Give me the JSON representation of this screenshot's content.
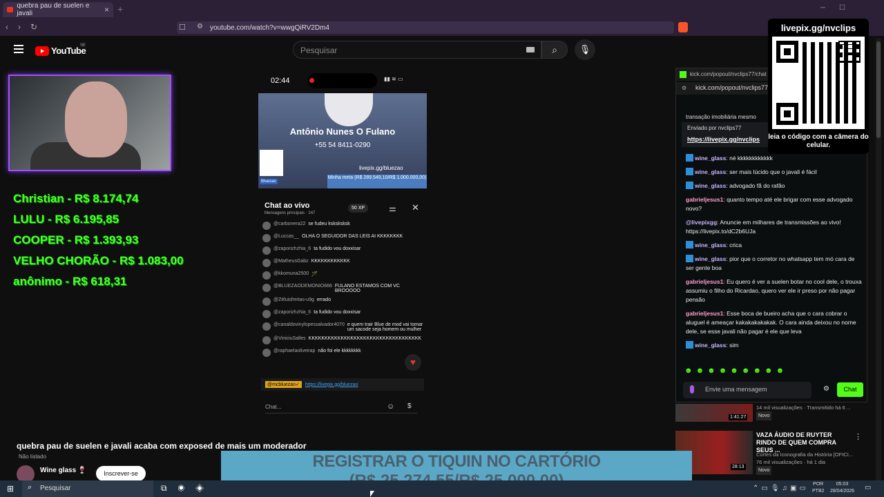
{
  "browser": {
    "tab_title": "quebra pau de suelen e javali",
    "url": "youtube.com/watch?v=wwgQiRV2Dm4"
  },
  "youtube": {
    "logo": "YouTube",
    "region": "SE",
    "search_placeholder": "Pesquisar"
  },
  "donors": [
    "Christian - R$ 8.174,74",
    "LULU - R$ 6.195,85",
    "COOPER - R$ 1.393,93",
    "VELHO CHORÃO - R$ 1.083,00",
    "anônimo - R$ 618,31"
  ],
  "phone": {
    "time": "02:44",
    "banner_name": "Antônio Nunes O Fulano",
    "banner_phone": "+55 54 8411-0290",
    "banner_link": "livepix.gg/bluezao",
    "banner_meta": "Minha meta (R$ 289.549,10/R$ 1.000.000,00)",
    "bluezao_tag": "Bluezao",
    "chat_title": "Chat ao vivo",
    "chat_sub": "Mensagens principais · 247",
    "xp": "50 XP",
    "messages": [
      {
        "user": "@carbonera22",
        "text": "se fudeu ksksksksk"
      },
      {
        "user": "@Luccas__",
        "text": "OLHA O SEGUIDOR DAS LEIS AI KKKKKKKK"
      },
      {
        "user": "@zaporizhzhia_6",
        "text": "ta fudido vou doxxisar"
      },
      {
        "user": "@MatheusGabz",
        "text": "KKKKKKKKKKKK"
      },
      {
        "user": "@kkomuna2500",
        "text": "🪄"
      },
      {
        "user": "@BLUEZAODEMONIO666",
        "text": "FULANO ESTAMOS COM VC BROOOOO"
      },
      {
        "user": "@Zéluisfreitas-u9g",
        "text": "errado"
      },
      {
        "user": "@zaporizhzhia_6",
        "text": "ta fudido vou doxxisar"
      },
      {
        "user": "@canaldovinylopessalvador4070",
        "text": "e quem trair Blue de mod vai tomar um sacode seja homem ou mulher"
      },
      {
        "user": "@ViniciuSalles",
        "text": "KKKKKKKKKKKKKKKKKKKKKKKKKKKKKKKKKKK"
      },
      {
        "user": "@raphaelaoliveirap",
        "text": "não foi ele kkkkkkkk"
      }
    ],
    "pinned_user": "@mcbluezao✓",
    "pinned_link": "https://livepix.gg/bluezao",
    "input_placeholder": "Chat..."
  },
  "video": {
    "title": "quebra pau de suelen e javali acaba com exposed de mais um moderador",
    "visibility": "Não listado",
    "channel": "Wine glass 🍷",
    "subscribe": "Inscrever-se"
  },
  "kick": {
    "tab_url": "kick.com/popout/nvclips77/chat",
    "addr": "kick.com/popout/nvclips77/chat",
    "topline": "transação imobiliária mesmo",
    "pin_sender": "Enviado por nvclips77",
    "pin_link": "https://livepix.gg/nvclips",
    "messages": [
      {
        "user": "wine_glass",
        "color": "#c9b6ff",
        "badge": true,
        "text": "né kkkkkkkkkkkk"
      },
      {
        "user": "wine_glass",
        "color": "#c9b6ff",
        "badge": true,
        "text": "ser mais lúcido que o javali é fácil"
      },
      {
        "user": "wine_glass",
        "color": "#c9b6ff",
        "badge": true,
        "text": "advogado fã do rafão"
      },
      {
        "user": "gabrieljesus1",
        "color": "#ff9ecf",
        "badge": false,
        "text": "quanto tempo até ele brigar com esse advogado novo?"
      },
      {
        "user": "@livepixgg",
        "color": "#c9b6ff",
        "badge": false,
        "text": "Anuncie em milhares de transmissões ao vivo! https://livepix.to/dC2b6UJa"
      },
      {
        "user": "wine_glass",
        "color": "#c9b6ff",
        "badge": true,
        "text": "crica"
      },
      {
        "user": "wine_glass",
        "color": "#c9b6ff",
        "badge": true,
        "text": "pior que o corretor no whatsapp tem mó cara de ser gente boa"
      },
      {
        "user": "gabrieljesus1",
        "color": "#ff9ecf",
        "badge": false,
        "text": "Eu quero é ver a suelen botar no cool dele, o trouxa assumiu o filho do Ricardao, quero ver ele ir preso por não pagar pensão"
      },
      {
        "user": "gabrieljesus1",
        "color": "#ff9ecf",
        "badge": false,
        "text": "Esse boca de bueiro acha que o cara cobrar o aluguel é ameaçar kakakakakakak. O cara ainda deixou no nome dele, se esse javali não pagar é ele que leva"
      },
      {
        "user": "wine_glass",
        "color": "#c9b6ff",
        "badge": true,
        "text": "sim"
      }
    ],
    "input_placeholder": "Envie uma mensagem",
    "send_label": "Chat"
  },
  "qr": {
    "title": "livepix.gg/nvclips",
    "caption": "leia o código com a câmera do celular."
  },
  "recommended": [
    {
      "duration": "1:41:27",
      "meta": "14 mil visualizações · Transmitido há 6 ...",
      "badge": "Novo"
    },
    {
      "title": "VAZA ÁUDIO DE RUYTER RINDO DE QUEM COMPRA SEUS ...",
      "duration": "28:13",
      "channel": "Cortes da Iconografia da História [OFICI...",
      "meta": "76 mil visualizações · há 1 dia",
      "badge": "Novo"
    }
  ],
  "goal": {
    "title": "REGISTRAR O TIQUIN NO CARTÓRIO",
    "amount": "(R$ 25.274,55/R$ 25.000,00)",
    "progress": 1.0
  },
  "taskbar": {
    "search": "Pesquisar",
    "lang": "POR\nPTB2",
    "time": "05:03",
    "date": "28/04/2026"
  }
}
